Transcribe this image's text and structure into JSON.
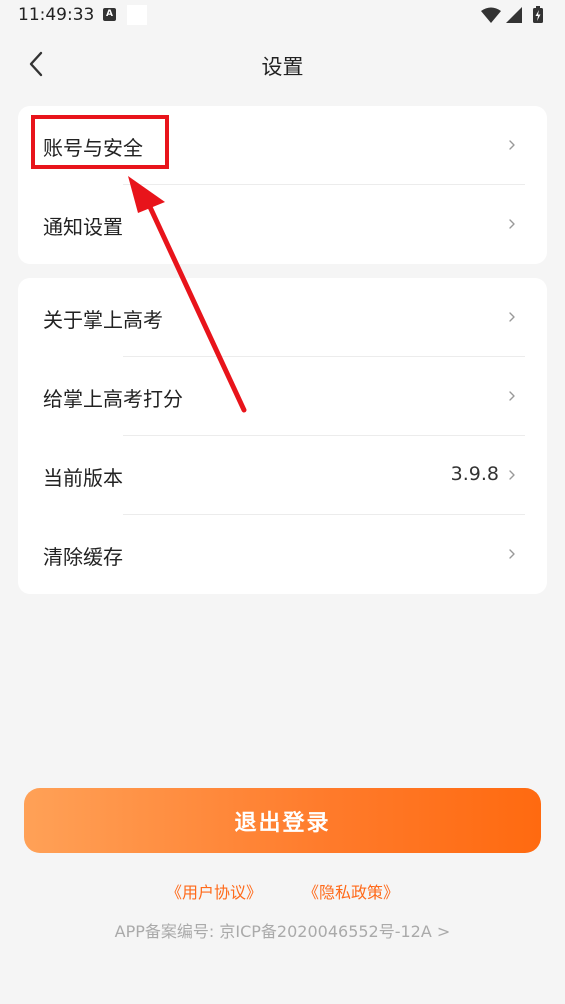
{
  "status_bar": {
    "time": "11:49:33",
    "a_icon_label": "A"
  },
  "nav": {
    "title": "设置"
  },
  "group1": {
    "items": [
      {
        "label": "账号与安全"
      },
      {
        "label": "通知设置"
      }
    ]
  },
  "group2": {
    "items": [
      {
        "label": "关于掌上高考"
      },
      {
        "label": "给掌上高考打分"
      },
      {
        "label": "当前版本",
        "value": "3.9.8"
      },
      {
        "label": "清除缓存"
      }
    ]
  },
  "logout": {
    "label": "退出登录"
  },
  "footer": {
    "user_agreement": "《用户协议》",
    "privacy_policy": "《隐私政策》",
    "icp": "APP备案编号: 京ICP备2020046552号-12A >"
  },
  "colors": {
    "accent": "#ff6a1a",
    "annotation": "#e8141b",
    "background": "#f5f5f5"
  },
  "icons": [
    "chevron-left-icon",
    "chevron-right-icon",
    "wifi-icon",
    "signal-icon",
    "battery-icon"
  ]
}
